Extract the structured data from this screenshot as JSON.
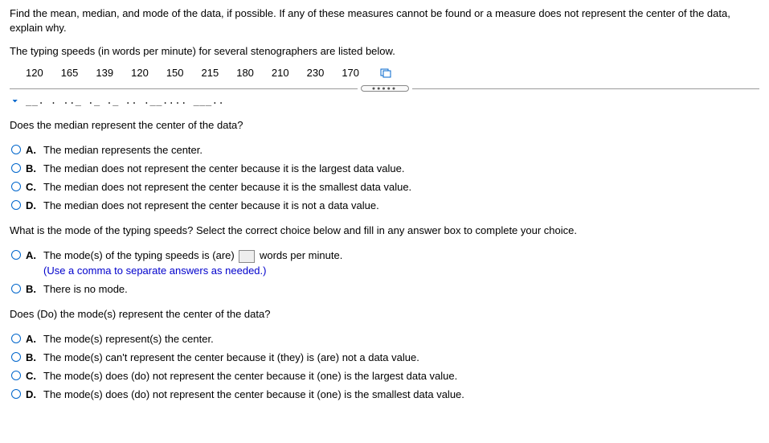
{
  "intro": "Find the mean, median, and mode of the data, if possible. If any of these measures cannot be found or a measure does not represent the center of the data, explain why.",
  "scenario": "The typing speeds (in words per minute) for several stenographers are listed below.",
  "data": {
    "v0": "120",
    "v1": "165",
    "v2": "139",
    "v3": "120",
    "v4": "150",
    "v5": "215",
    "v6": "180",
    "v7": "210",
    "v8": "230",
    "v9": "170"
  },
  "partial_cutoff": "__.   . .._ ._ ._ .. .__.... ___..",
  "q1": {
    "prompt": "Does the median represent the center of the data?",
    "a": {
      "label": "A.",
      "text": "The median represents the center."
    },
    "b": {
      "label": "B.",
      "text": "The median does not represent the center because it is the largest data value."
    },
    "c": {
      "label": "C.",
      "text": "The median does not represent the center because it is the smallest data value."
    },
    "d": {
      "label": "D.",
      "text": "The median does not represent the center because it is not a data value."
    }
  },
  "q2": {
    "prompt": "What is the mode of the typing speeds? Select the correct choice below and fill in any answer box to complete your choice.",
    "a": {
      "label": "A.",
      "pre": "The mode(s) of the typing speeds is (are)",
      "post": " words per minute.",
      "hint": "(Use a comma to separate answers as needed.)"
    },
    "b": {
      "label": "B.",
      "text": "There is no mode."
    }
  },
  "q3": {
    "prompt": "Does (Do) the mode(s) represent the center of the data?",
    "a": {
      "label": "A.",
      "text": "The mode(s) represent(s) the center."
    },
    "b": {
      "label": "B.",
      "text": "The mode(s) can't represent the center because it (they) is (are) not a data value."
    },
    "c": {
      "label": "C.",
      "text": "The mode(s) does (do) not represent the center because it (one) is the largest data value."
    },
    "d": {
      "label": "D.",
      "text": "The mode(s) does (do) not represent the center because it (one) is the smallest data value."
    }
  }
}
